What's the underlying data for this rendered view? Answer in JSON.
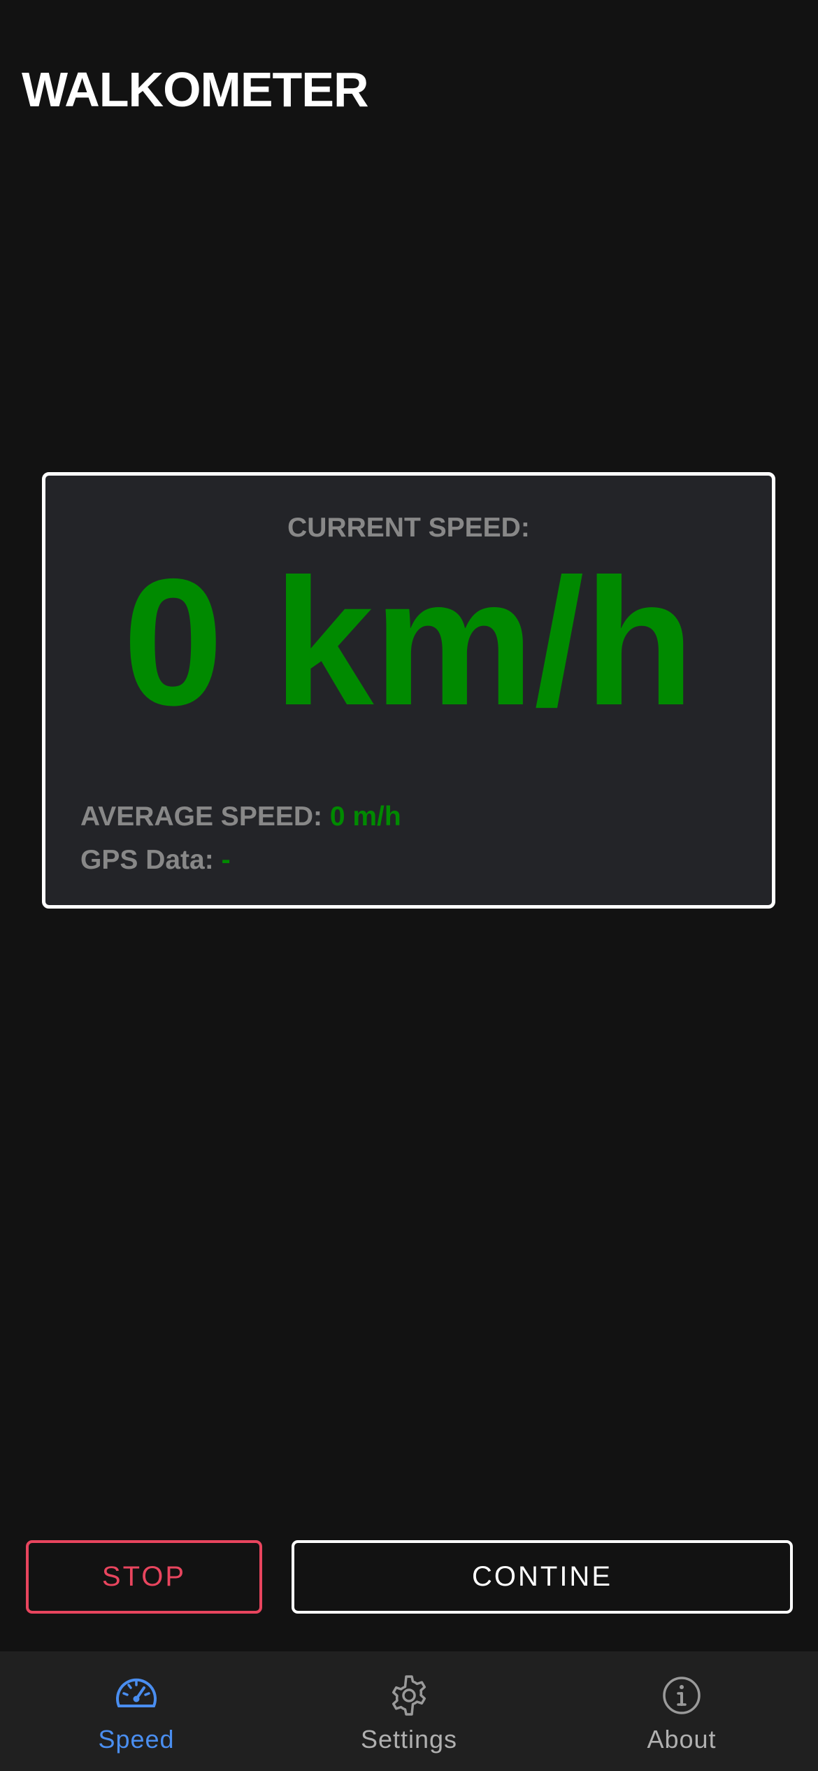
{
  "app": {
    "title": "WALKOMETER"
  },
  "speed_card": {
    "current_label": "CURRENT SPEED:",
    "current_value": "0 km/h",
    "average_label": "AVERAGE SPEED:",
    "average_value": "0 m/h",
    "gps_label": "GPS Data:",
    "gps_value": "-"
  },
  "actions": {
    "stop_label": "STOP",
    "continue_label": "CONTINE"
  },
  "tabbar": {
    "tabs": [
      {
        "label": "Speed",
        "icon": "speedometer-icon",
        "active": true
      },
      {
        "label": "Settings",
        "icon": "gear-icon",
        "active": false
      },
      {
        "label": "About",
        "icon": "info-icon",
        "active": false
      }
    ]
  },
  "colors": {
    "background": "#121212",
    "card": "#232428",
    "accent_green": "#008a00",
    "stop_red": "#e8455e",
    "active_tab_blue": "#4a8ef0"
  }
}
